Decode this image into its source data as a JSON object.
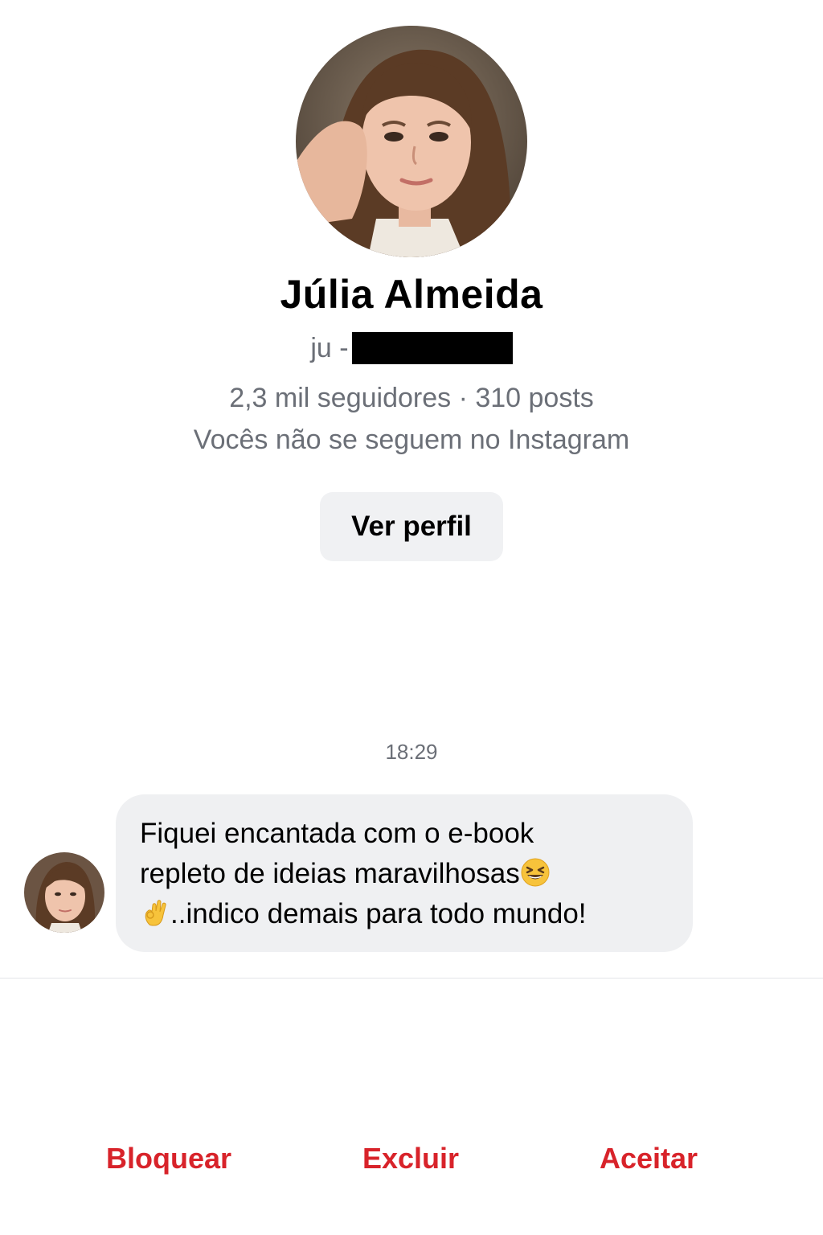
{
  "profile": {
    "photo_icon": "profile-photo",
    "name": "Júlia Almeida",
    "handle_prefix": "ju -",
    "stats": "2,3 mil seguidores · 310 posts",
    "follow_note": "Vocês não se seguem no Instagram",
    "view_profile_label": "Ver perfil"
  },
  "conversation": {
    "timestamp": "18:29",
    "message": {
      "line1": "Fiquei encantada com o e-book",
      "line2": "repleto de ideias maravilhosas",
      "line3": "..indico demais para todo mundo!",
      "emoji1": "grinning-squinting-face",
      "emoji2": "ok-hand"
    }
  },
  "actions": {
    "block_label": "Bloquear",
    "delete_label": "Excluir",
    "accept_label": "Aceitar"
  },
  "colors": {
    "action_red": "#d8232a",
    "secondary_text": "#6b6f77",
    "bubble_bg": "#eff0f2",
    "button_bg": "#f0f1f3"
  }
}
